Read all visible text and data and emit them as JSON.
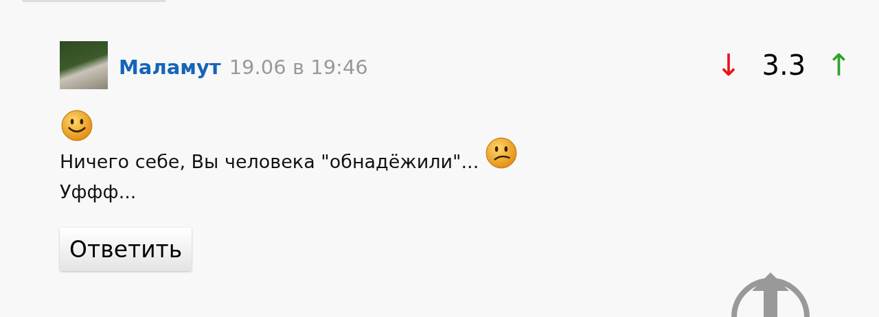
{
  "comment": {
    "author": "Маламут",
    "date": "19.06 в 19:46",
    "rating": {
      "down": "↓",
      "score": "3.3",
      "up": "↑"
    },
    "body": [
      [
        {
          "kind": "smile"
        }
      ],
      [
        {
          "kind": "text",
          "text": "Ничего себе, Вы человека \"обнадёжили\"..."
        },
        {
          "kind": "uneasy"
        }
      ],
      [
        {
          "kind": "text",
          "text": "Уффф..."
        }
      ]
    ],
    "reply_button": "Ответить"
  }
}
